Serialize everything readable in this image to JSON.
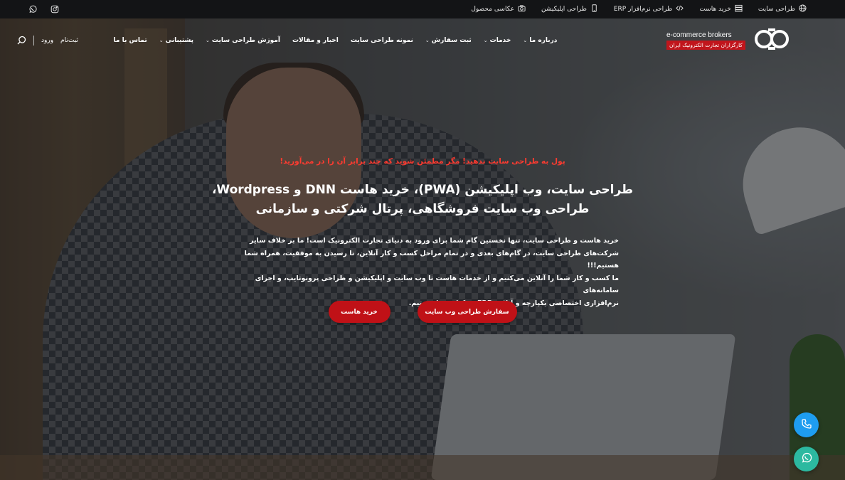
{
  "topbar": {
    "links": [
      {
        "label": "طراحی سایت",
        "icon": "globe-icon"
      },
      {
        "label": "خرید هاست",
        "icon": "server-icon"
      },
      {
        "label": "طراحی نرم‌افزار ERP",
        "icon": "code-icon"
      },
      {
        "label": "طراحی اپلیکیشن",
        "icon": "mobile-icon"
      },
      {
        "label": "عکاسی محصول",
        "icon": "camera-icon"
      }
    ],
    "socials": [
      "whatsapp-icon",
      "instagram-icon"
    ]
  },
  "logo": {
    "en": "e-commerce brokers",
    "fa": "کارگزاران تجارت الکترونیک ایران"
  },
  "nav": {
    "items": [
      {
        "label": "درباره ما",
        "dropdown": true
      },
      {
        "label": "خدمات",
        "dropdown": true
      },
      {
        "label": "ثبت سفارش",
        "dropdown": true
      },
      {
        "label": "نمونه طراحی سایت",
        "dropdown": false
      },
      {
        "label": "اخبار و مقالات",
        "dropdown": false
      },
      {
        "label": "آموزش طراحی سایت",
        "dropdown": true
      },
      {
        "label": "پشتیبانی",
        "dropdown": true
      },
      {
        "label": "تماس با ما",
        "dropdown": false
      }
    ],
    "login": "ورود",
    "register": "ثبت‌نام"
  },
  "hero": {
    "promo": "پول به طراحی سایت ندهید! مگر مطمئن شوید که چند برابر آن را در می‌آورید!",
    "title_line1": "طراحی سایت، وب اپلیکیشن (PWA)، خرید هاست DNN و Wordpress،",
    "title_line2": "طراحی وب سایت فروشگاهی، پرتال شرکتی و سازمانی",
    "desc_line1": "خرید هاست و طراحی سایت، تنها نخستین گام شما برای ورود به دنیای تجارت الکترونیک است! ما بر خلاف سایر",
    "desc_line2": "شرکت‌های طراحی سایت، در گام‌های بعدی و در تمام مراحل کسب و کار آنلاین، تا رسیدن به موفقیت، همراه شما هستیم!!!",
    "desc_line3": "ما کسب و کار شما را آنلاین می‌کنیم و از خدمات هاست تا وب سایت و اپلیکیشن و طراحی پروتوتایپ، و اجرای سامانه‌های",
    "desc_line4": "نرم‌افزاری اختصاصی یکپارچه و آنلاین ERP در کنار شما هستیم.",
    "cta_primary": "سفارش طراحی وب سایت",
    "cta_secondary": "خرید هاست"
  },
  "colors": {
    "accent": "#c01117",
    "promo": "#ff3b30",
    "topbar": "#131416",
    "phone_button": "#1e9df0",
    "whatsapp_button": "#2cb9a0"
  }
}
